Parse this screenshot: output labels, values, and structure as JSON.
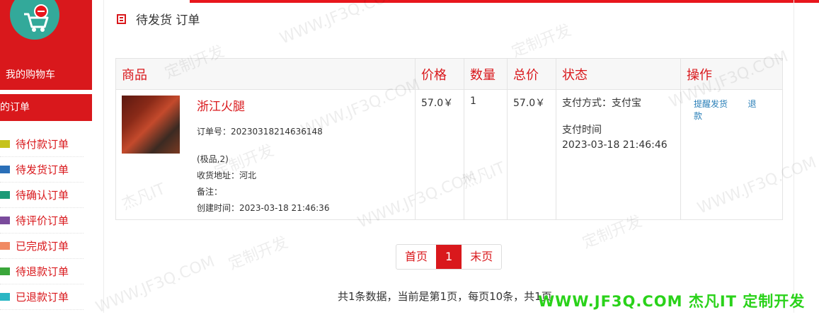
{
  "sidebar": {
    "cart_label": "我的购物车",
    "orders_head": "的订单",
    "items": [
      {
        "label": "待付款订单",
        "color": "#c6c21b"
      },
      {
        "label": "待发货订单",
        "color": "#2a6fb8"
      },
      {
        "label": "待确认订单",
        "color": "#1b9a77"
      },
      {
        "label": "待评价订单",
        "color": "#7a4b9c"
      },
      {
        "label": "已完成订单",
        "color": "#f08a63"
      },
      {
        "label": "待退款订单",
        "color": "#3aa63a"
      },
      {
        "label": "已退款订单",
        "color": "#2ab6c4"
      }
    ]
  },
  "page": {
    "title": "待发货 订单"
  },
  "table": {
    "headers": [
      "商品",
      "价格",
      "数量",
      "总价",
      "状态",
      "操作"
    ],
    "row": {
      "name": "浙江火腿",
      "order_no": "订单号：20230318214636148",
      "spec": "(极品,2)",
      "address": "收货地址：河北",
      "remark": "备注：",
      "created": "创建时间：2023-03-18 21:46:36",
      "price": "57.0￥",
      "qty": "1",
      "total": "57.0￥",
      "pay_method": "支付方式：支付宝",
      "pay_time_label": "支付时间",
      "pay_time": "2023-03-18 21:46:46",
      "op_remind": "提醒发货",
      "op_refund": "退款"
    }
  },
  "pager": {
    "first": "首页",
    "current": "1",
    "last": "末页"
  },
  "summary": "共1条数据，当前是第1页，每页10条，共1页",
  "watermark": {
    "site": "WWW.JF3Q.COM",
    "brand": "杰凡IT",
    "service": "定制开发",
    "footer": "WWW.JF3Q.COM 杰凡IT  定制开发"
  },
  "colors": {
    "accent": "#d9181c",
    "link": "#2a7fb8"
  }
}
